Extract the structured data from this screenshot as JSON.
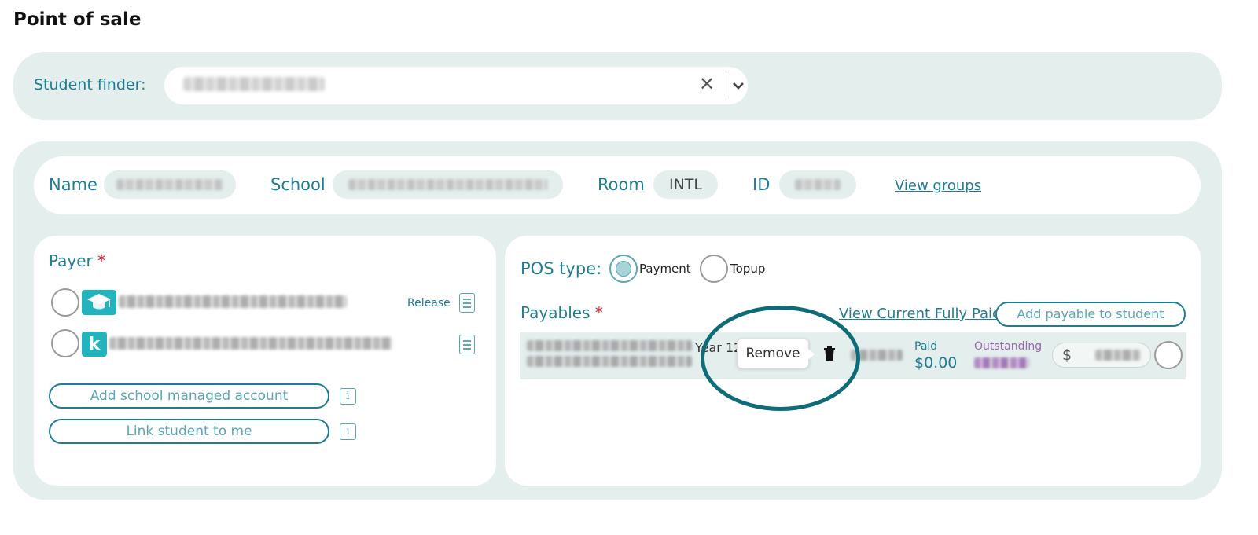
{
  "page": {
    "title": "Point of sale"
  },
  "finder": {
    "label": "Student finder:",
    "value": "Aaron b Bukky 2nd b"
  },
  "student_info": {
    "name_label": "Name",
    "name_value": "Aaron b Bukky",
    "school_label": "School",
    "school_value": "Westlake Boys High School",
    "room_label": "Room",
    "room_value": "INTL",
    "id_label": "ID",
    "id_value": "22058",
    "view_groups": "View groups"
  },
  "payer": {
    "title": "Payer",
    "required_mark": "*",
    "accounts": [
      {
        "logo": "mortarboard-logo",
        "label": "School managed account",
        "release": "Release"
      },
      {
        "logo": "k-logo",
        "logo_text": "k",
        "label": "Kindo linked family account"
      }
    ],
    "add_school_account": "Add school managed account",
    "link_student": "Link student to me",
    "info_glyph": "i"
  },
  "pos": {
    "type_label": "POS type:",
    "options": [
      "Payment",
      "Topup"
    ],
    "selected": "Payment",
    "payables_label": "Payables",
    "required_mark": "*",
    "view_fully_paid": "View Current Fully Paid",
    "add_payable": "Add payable to student",
    "payable": {
      "description": "2024 Outdoor Education Curriculum Contribution",
      "year": "Year 12",
      "code": "OE2024",
      "paid_label": "Paid",
      "paid_value": "$0.00",
      "outstanding_label": "Outstanding",
      "outstanding_value": "$795.00",
      "currency": "$",
      "amount": "795.00"
    },
    "tooltip": "Remove"
  },
  "colors": {
    "accent": "#1f7c91",
    "panel_bg": "#e3eeed",
    "required": "#e0202a",
    "outstanding": "#9b66b4",
    "highlight": "#0e6b78"
  }
}
